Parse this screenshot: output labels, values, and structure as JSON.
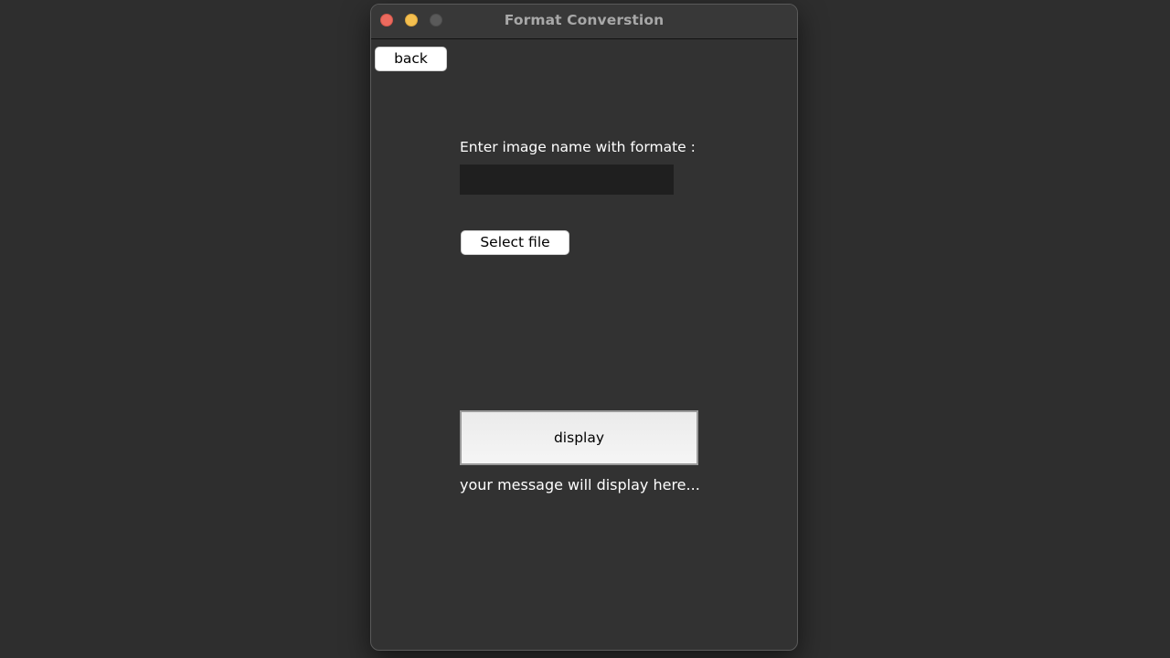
{
  "window": {
    "title": "Format Converstion"
  },
  "toolbar": {
    "back_label": "back"
  },
  "form": {
    "prompt_label": "Enter image name with formate :",
    "image_name_value": "",
    "select_file_label": "Select file",
    "display_label": "display",
    "message": "your message will display here..."
  },
  "colors": {
    "close": "#ec6a5e",
    "minimize": "#f4bf4f",
    "zoom": "#5a5a5a",
    "background": "#323232"
  },
  "icons": [
    "close-icon",
    "minimize-icon",
    "zoom-icon"
  ]
}
